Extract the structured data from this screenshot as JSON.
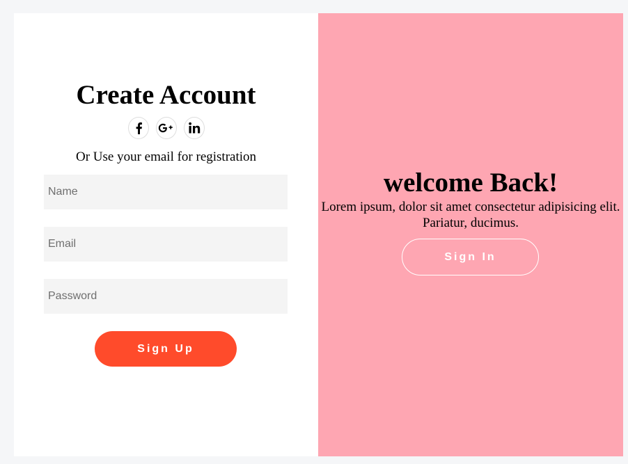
{
  "signup_panel": {
    "title": "Create Account",
    "social_icons": [
      "facebook-icon",
      "google-plus-icon",
      "linkedin-icon"
    ],
    "subtitle": "Or Use your email for registration",
    "fields": {
      "name_placeholder": "Name",
      "email_placeholder": "Email",
      "password_placeholder": "Password"
    },
    "submit_label": "Sign Up"
  },
  "welcome_panel": {
    "title": "welcome Back!",
    "text": "Lorem ipsum, dolor sit amet consectetur adipisicing elit. Pariatur, ducimus.",
    "signin_label": "Sign In"
  },
  "colors": {
    "page_background": "#f5f6f8",
    "panel_background": "#ffffff",
    "overlay_background": "#fea6b2",
    "accent": "#ff4b2b",
    "input_background": "#f4f4f4"
  }
}
